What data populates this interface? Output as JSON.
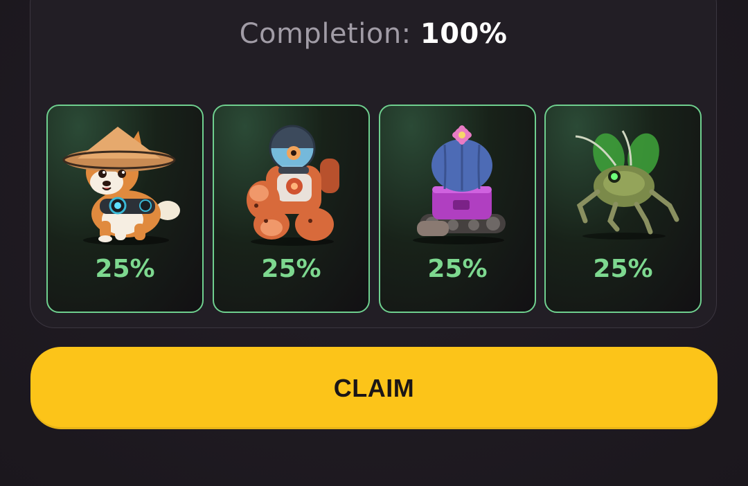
{
  "completion": {
    "label": "Completion:",
    "value": "100%"
  },
  "cards": [
    {
      "name": "shiba-samurai",
      "percent": "25%"
    },
    {
      "name": "orange-robot",
      "percent": "25%"
    },
    {
      "name": "cactus-tank",
      "percent": "25%"
    },
    {
      "name": "green-bug-drone",
      "percent": "25%"
    }
  ],
  "claim": {
    "label": "CLAIM"
  },
  "colors": {
    "accent_green": "#7dd88f",
    "card_border": "#6fd08f",
    "claim_button": "#fcc419",
    "background": "#1e1a21"
  }
}
